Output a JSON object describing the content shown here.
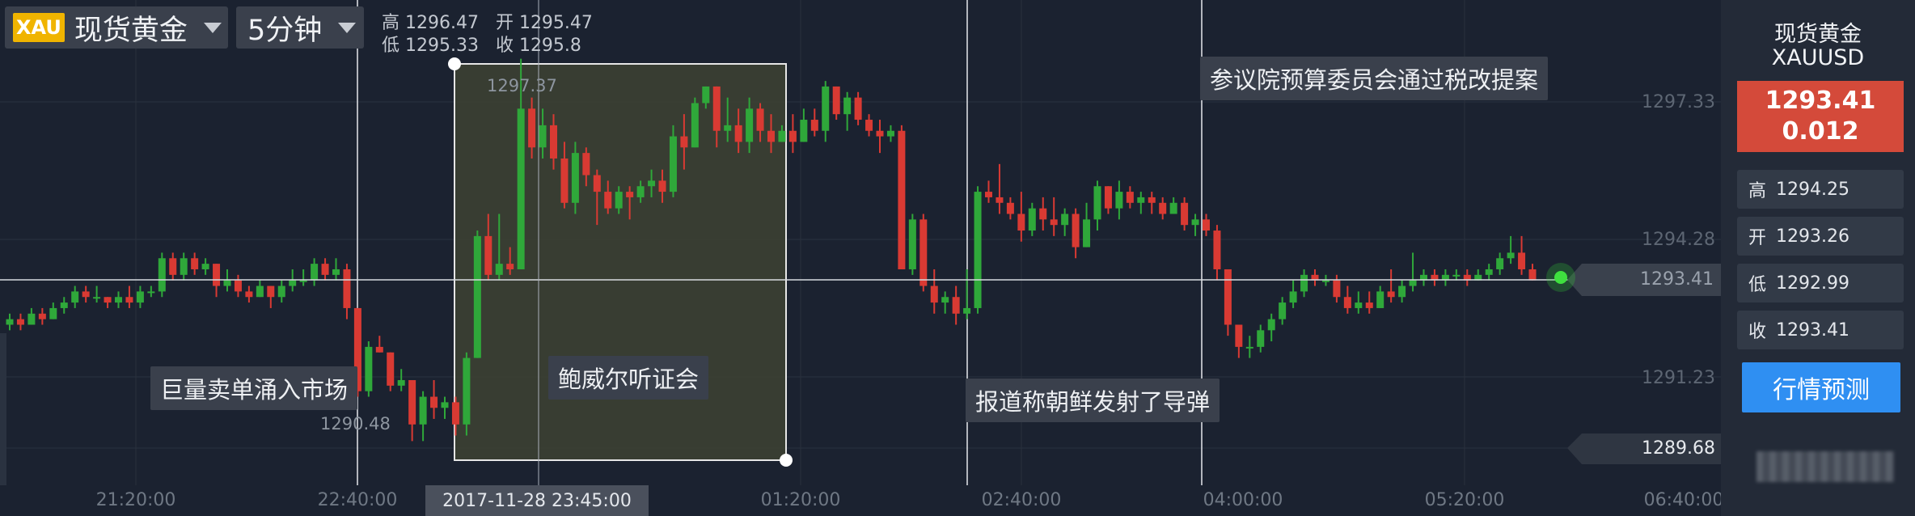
{
  "header": {
    "symbol_badge": "XAU",
    "symbol_name": "现货黄金",
    "timeframe": "5分钟",
    "ohlc_line1": "高 1296.47   开 1295.47",
    "ohlc_line2": "低 1295.33   收 1295.8"
  },
  "chart_data": {
    "type": "candlestick",
    "interval": "5分钟",
    "y_ticks": [
      "1297.33",
      "1294.28",
      "1293.41",
      "1291.23"
    ],
    "x_ticks": [
      "21:20:00",
      "22:40:00",
      "01:20:00",
      "02:40:00",
      "04:00:00",
      "05:20:00",
      "06:40:00"
    ],
    "crosshair_time": "2017-11-28 23:45:00",
    "selection_high": "1297.37",
    "selection_low": "1289.68",
    "marked_low": "1290.48",
    "current_price": "1293.41",
    "up_color": "#2fa83a",
    "down_color": "#d93a33",
    "candles": [
      [
        1292.6,
        1292.8,
        1292.5,
        1292.7
      ],
      [
        1292.7,
        1292.8,
        1292.5,
        1292.6
      ],
      [
        1292.6,
        1292.9,
        1292.6,
        1292.8
      ],
      [
        1292.8,
        1292.9,
        1292.6,
        1292.7
      ],
      [
        1292.7,
        1293.0,
        1292.7,
        1292.9
      ],
      [
        1292.9,
        1293.1,
        1292.8,
        1293.0
      ],
      [
        1293.0,
        1293.3,
        1292.9,
        1293.2
      ],
      [
        1293.2,
        1293.3,
        1293.0,
        1293.1
      ],
      [
        1293.1,
        1293.3,
        1293.0,
        1293.1
      ],
      [
        1293.1,
        1293.1,
        1292.9,
        1293.0
      ],
      [
        1293.0,
        1293.2,
        1292.9,
        1293.1
      ],
      [
        1293.1,
        1293.3,
        1292.9,
        1293.0
      ],
      [
        1293.0,
        1293.3,
        1292.9,
        1293.2
      ],
      [
        1293.2,
        1293.3,
        1293.1,
        1293.2
      ],
      [
        1293.2,
        1293.9,
        1293.1,
        1293.8
      ],
      [
        1293.8,
        1293.9,
        1293.4,
        1293.5
      ],
      [
        1293.5,
        1293.9,
        1293.4,
        1293.8
      ],
      [
        1293.8,
        1293.9,
        1293.5,
        1293.6
      ],
      [
        1293.6,
        1293.8,
        1293.5,
        1293.7
      ],
      [
        1293.7,
        1293.7,
        1293.1,
        1293.3
      ],
      [
        1293.3,
        1293.6,
        1293.2,
        1293.4
      ],
      [
        1293.4,
        1293.5,
        1293.1,
        1293.2
      ],
      [
        1293.2,
        1293.3,
        1293.0,
        1293.1
      ],
      [
        1293.1,
        1293.4,
        1293.1,
        1293.3
      ],
      [
        1293.3,
        1293.3,
        1292.9,
        1293.1
      ],
      [
        1293.1,
        1293.4,
        1293.0,
        1293.3
      ],
      [
        1293.3,
        1293.6,
        1293.2,
        1293.4
      ],
      [
        1293.4,
        1293.6,
        1293.3,
        1293.4
      ],
      [
        1293.4,
        1293.8,
        1293.3,
        1293.7
      ],
      [
        1293.7,
        1293.8,
        1293.4,
        1293.5
      ],
      [
        1293.5,
        1293.8,
        1293.4,
        1293.6
      ],
      [
        1293.6,
        1293.7,
        1292.7,
        1292.9
      ],
      [
        1292.9,
        1292.9,
        1291.3,
        1291.4
      ],
      [
        1291.4,
        1292.3,
        1291.3,
        1292.2
      ],
      [
        1292.2,
        1292.4,
        1292.1,
        1292.1
      ],
      [
        1292.1,
        1292.1,
        1291.4,
        1291.5
      ],
      [
        1291.5,
        1291.8,
        1291.4,
        1291.6
      ],
      [
        1291.6,
        1291.6,
        1290.5,
        1290.8
      ],
      [
        1290.8,
        1291.4,
        1290.5,
        1291.3
      ],
      [
        1291.3,
        1291.6,
        1290.9,
        1291.1
      ],
      [
        1291.1,
        1291.3,
        1290.9,
        1291.2
      ],
      [
        1291.2,
        1291.3,
        1290.6,
        1290.8
      ],
      [
        1290.8,
        1292.1,
        1290.6,
        1292.0
      ],
      [
        1292.0,
        1294.3,
        1292.0,
        1294.2
      ],
      [
        1294.2,
        1294.6,
        1293.4,
        1293.5
      ],
      [
        1293.5,
        1294.6,
        1293.4,
        1293.7
      ],
      [
        1293.7,
        1294.0,
        1293.5,
        1293.6
      ],
      [
        1293.6,
        1297.4,
        1293.6,
        1296.5
      ],
      [
        1296.5,
        1296.7,
        1295.6,
        1295.8
      ],
      [
        1295.8,
        1296.5,
        1295.6,
        1296.2
      ],
      [
        1296.2,
        1296.4,
        1295.4,
        1295.6
      ],
      [
        1295.6,
        1295.9,
        1294.7,
        1294.8
      ],
      [
        1294.8,
        1295.9,
        1294.6,
        1295.7
      ],
      [
        1295.7,
        1295.8,
        1295.1,
        1295.3
      ],
      [
        1295.3,
        1295.4,
        1294.4,
        1295.0
      ],
      [
        1295.0,
        1295.2,
        1294.6,
        1294.7
      ],
      [
        1294.7,
        1295.1,
        1294.6,
        1295.0
      ],
      [
        1295.0,
        1295.1,
        1294.5,
        1294.9
      ],
      [
        1294.9,
        1295.2,
        1294.8,
        1295.1
      ],
      [
        1295.1,
        1295.4,
        1294.9,
        1295.2
      ],
      [
        1295.2,
        1295.4,
        1294.8,
        1295.0
      ],
      [
        1295.0,
        1296.2,
        1294.9,
        1296.0
      ],
      [
        1296.0,
        1296.4,
        1295.4,
        1295.8
      ],
      [
        1295.8,
        1296.7,
        1295.8,
        1296.6
      ],
      [
        1296.6,
        1296.9,
        1296.5,
        1296.9
      ],
      [
        1296.9,
        1296.9,
        1295.8,
        1296.1
      ],
      [
        1296.1,
        1296.7,
        1295.9,
        1296.2
      ],
      [
        1296.2,
        1296.5,
        1295.7,
        1295.9
      ],
      [
        1295.9,
        1296.7,
        1295.7,
        1296.5
      ],
      [
        1296.5,
        1296.6,
        1295.9,
        1296.1
      ],
      [
        1296.1,
        1296.4,
        1295.7,
        1295.9
      ],
      [
        1295.9,
        1296.2,
        1295.9,
        1296.1
      ],
      [
        1296.1,
        1296.4,
        1295.7,
        1295.9
      ],
      [
        1295.9,
        1296.5,
        1295.9,
        1296.3
      ],
      [
        1296.3,
        1296.5,
        1296.0,
        1296.1
      ],
      [
        1296.1,
        1297.0,
        1295.9,
        1296.9
      ],
      [
        1296.9,
        1296.9,
        1296.3,
        1296.4
      ],
      [
        1296.4,
        1296.8,
        1296.1,
        1296.7
      ],
      [
        1296.7,
        1296.8,
        1296.2,
        1296.3
      ],
      [
        1296.3,
        1296.4,
        1296.0,
        1296.1
      ],
      [
        1296.1,
        1296.3,
        1295.7,
        1296.0
      ],
      [
        1296.0,
        1296.2,
        1295.9,
        1296.1
      ],
      [
        1296.1,
        1296.2,
        1293.6,
        1293.6
      ],
      [
        1293.6,
        1294.6,
        1293.5,
        1294.5
      ],
      [
        1294.5,
        1294.6,
        1293.2,
        1293.3
      ],
      [
        1293.3,
        1293.6,
        1292.8,
        1293.0
      ],
      [
        1293.0,
        1293.2,
        1292.8,
        1293.1
      ],
      [
        1293.1,
        1293.3,
        1292.6,
        1292.8
      ],
      [
        1292.8,
        1293.6,
        1292.7,
        1292.9
      ],
      [
        1292.9,
        1295.1,
        1292.8,
        1295.0
      ],
      [
        1295.0,
        1295.2,
        1294.8,
        1294.9
      ],
      [
        1294.9,
        1295.5,
        1294.6,
        1294.8
      ],
      [
        1294.8,
        1294.9,
        1294.5,
        1294.6
      ],
      [
        1294.6,
        1295.0,
        1294.1,
        1294.3
      ],
      [
        1294.3,
        1294.8,
        1294.2,
        1294.7
      ],
      [
        1294.7,
        1294.9,
        1294.3,
        1294.5
      ],
      [
        1294.5,
        1294.9,
        1294.2,
        1294.4
      ],
      [
        1294.4,
        1294.7,
        1294.2,
        1294.6
      ],
      [
        1294.6,
        1294.7,
        1293.8,
        1294.0
      ],
      [
        1294.0,
        1294.8,
        1294.0,
        1294.5
      ],
      [
        1294.5,
        1295.2,
        1294.3,
        1295.1
      ],
      [
        1295.1,
        1295.1,
        1294.6,
        1294.7
      ],
      [
        1294.7,
        1295.2,
        1294.5,
        1295.0
      ],
      [
        1295.0,
        1295.1,
        1294.7,
        1294.8
      ],
      [
        1294.8,
        1295.0,
        1294.6,
        1294.9
      ],
      [
        1294.9,
        1295.0,
        1294.6,
        1294.8
      ],
      [
        1294.8,
        1294.9,
        1294.5,
        1294.6
      ],
      [
        1294.6,
        1294.9,
        1294.6,
        1294.8
      ],
      [
        1294.8,
        1294.9,
        1294.3,
        1294.4
      ],
      [
        1294.4,
        1294.6,
        1294.2,
        1294.5
      ],
      [
        1294.5,
        1294.6,
        1294.2,
        1294.3
      ],
      [
        1294.3,
        1294.4,
        1293.4,
        1293.6
      ],
      [
        1293.6,
        1293.6,
        1292.4,
        1292.6
      ],
      [
        1292.6,
        1292.6,
        1292.0,
        1292.2
      ],
      [
        1292.2,
        1292.4,
        1292.0,
        1292.2
      ],
      [
        1292.2,
        1292.6,
        1292.1,
        1292.5
      ],
      [
        1292.5,
        1292.8,
        1292.3,
        1292.7
      ],
      [
        1292.7,
        1293.1,
        1292.6,
        1293.0
      ],
      [
        1293.0,
        1293.4,
        1292.9,
        1293.2
      ],
      [
        1293.2,
        1293.6,
        1293.1,
        1293.5
      ],
      [
        1293.5,
        1293.6,
        1293.3,
        1293.4
      ],
      [
        1293.4,
        1293.5,
        1293.3,
        1293.4
      ],
      [
        1293.4,
        1293.5,
        1293.0,
        1293.1
      ],
      [
        1293.1,
        1293.3,
        1292.8,
        1292.9
      ],
      [
        1292.9,
        1293.2,
        1292.8,
        1293.0
      ],
      [
        1293.0,
        1293.2,
        1292.8,
        1292.9
      ],
      [
        1292.9,
        1293.3,
        1292.9,
        1293.2
      ],
      [
        1293.2,
        1293.6,
        1293.0,
        1293.1
      ],
      [
        1293.1,
        1293.4,
        1293.0,
        1293.3
      ],
      [
        1293.3,
        1293.9,
        1293.2,
        1293.4
      ],
      [
        1293.4,
        1293.6,
        1293.3,
        1293.5
      ],
      [
        1293.5,
        1293.6,
        1293.3,
        1293.4
      ],
      [
        1293.4,
        1293.6,
        1293.3,
        1293.5
      ],
      [
        1293.5,
        1293.6,
        1293.4,
        1293.5
      ],
      [
        1293.5,
        1293.6,
        1293.3,
        1293.4
      ],
      [
        1293.4,
        1293.6,
        1293.4,
        1293.5
      ],
      [
        1293.5,
        1293.7,
        1293.4,
        1293.6
      ],
      [
        1293.6,
        1293.9,
        1293.5,
        1293.8
      ],
      [
        1293.8,
        1294.2,
        1293.7,
        1293.9
      ],
      [
        1293.9,
        1294.2,
        1293.5,
        1293.6
      ],
      [
        1293.6,
        1293.7,
        1293.4,
        1293.4
      ]
    ]
  },
  "annotations": {
    "sell_flood": "巨量卖单涌入市场",
    "powell": "鲍威尔听证会",
    "missile": "报道称朝鲜发射了导弹",
    "senate": "参议院预算委员会通过税改提案"
  },
  "sidebar": {
    "title": "现货黄金",
    "code": "XAUUSD",
    "price": "1293.41",
    "change": "0.012",
    "high_label": "高",
    "high_value": "1294.25",
    "open_label": "开",
    "open_value": "1293.26",
    "low_label": "低",
    "low_value": "1292.99",
    "close_label": "收",
    "close_value": "1293.41",
    "predict_button": "行情预测",
    "price_color": "#d44a3a",
    "button_color": "#2f8ff2"
  }
}
